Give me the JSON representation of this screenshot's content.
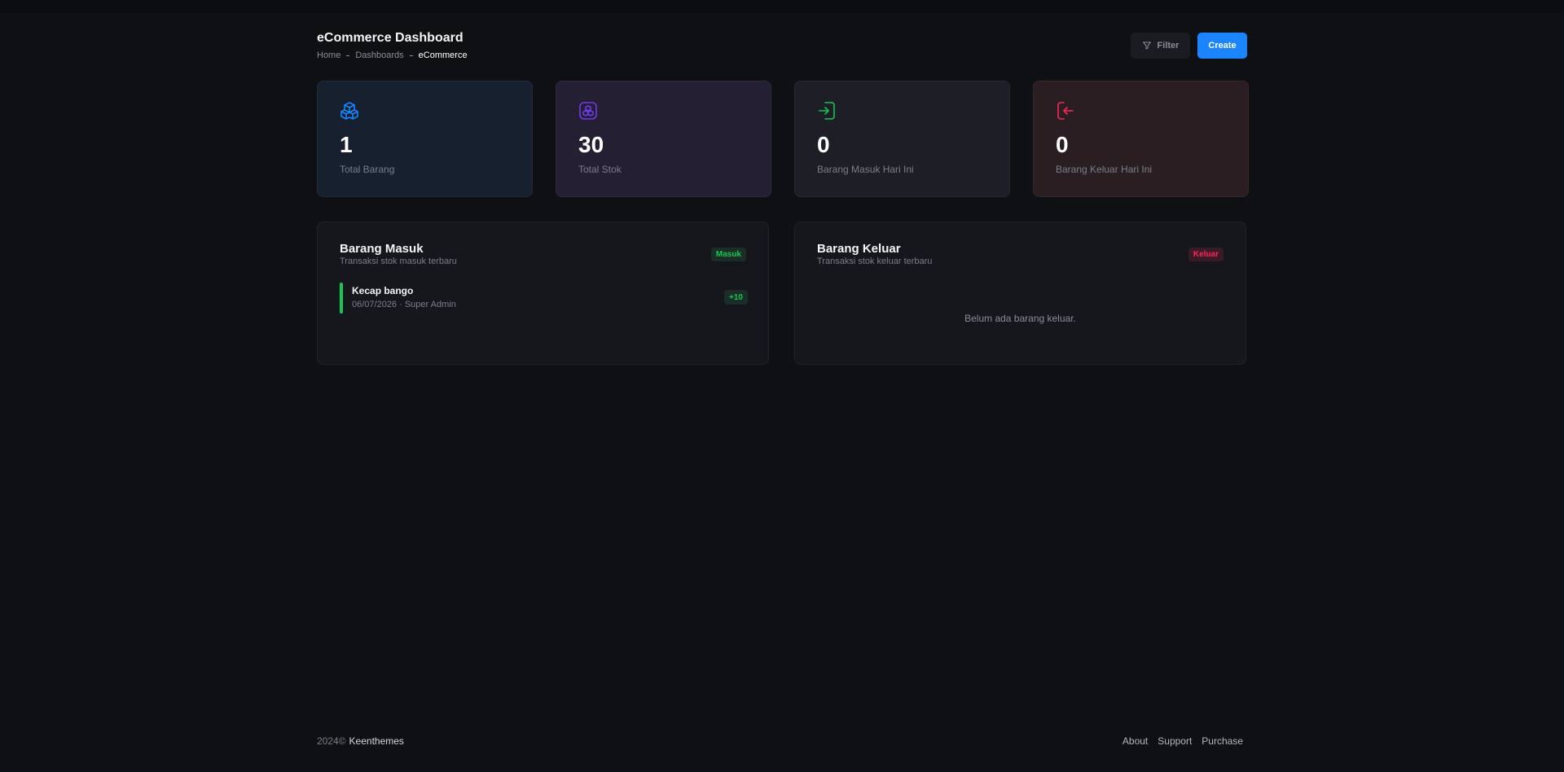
{
  "header": {
    "title": "eCommerce Dashboard",
    "breadcrumb": [
      "Home",
      "Dashboards",
      "eCommerce"
    ],
    "filter_label": "Filter",
    "create_label": "Create"
  },
  "stats": [
    {
      "value": "1",
      "label": "Total Barang",
      "icon": "boxes-icon",
      "color": "#1b84ff"
    },
    {
      "value": "30",
      "label": "Total Stok",
      "icon": "stock-icon",
      "color": "#7239ea"
    },
    {
      "value": "0",
      "label": "Barang Masuk Hari Ini",
      "icon": "login-icon",
      "color": "#17c653"
    },
    {
      "value": "0",
      "label": "Barang Keluar Hari Ini",
      "icon": "logout-icon",
      "color": "#f8285a"
    }
  ],
  "panels": {
    "incoming": {
      "title": "Barang Masuk",
      "subtitle": "Transaksi stok masuk terbaru",
      "badge": "Masuk",
      "items": [
        {
          "name": "Kecap bango",
          "meta": "06/07/2026 · Super Admin",
          "qty": "+10"
        }
      ]
    },
    "outgoing": {
      "title": "Barang Keluar",
      "subtitle": "Transaksi stok keluar terbaru",
      "badge": "Keluar",
      "empty_text": "Belum ada barang keluar."
    }
  },
  "footer": {
    "year": "2024©",
    "brand": "Keenthemes",
    "links": [
      "About",
      "Support",
      "Purchase"
    ]
  },
  "colors": {
    "accent": "#1b84ff",
    "success": "#17c653",
    "danger": "#f8285a",
    "purple": "#7239ea"
  }
}
